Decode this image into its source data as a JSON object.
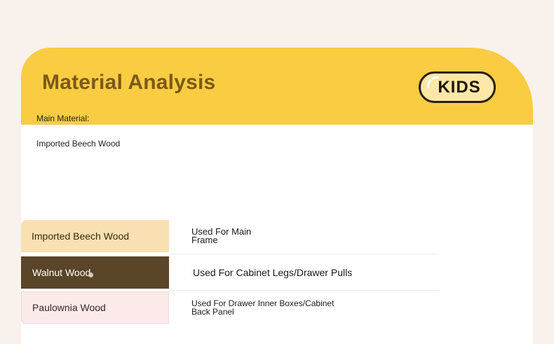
{
  "header": {
    "title": "Material Analysis",
    "badge": "KIDS"
  },
  "info": {
    "label": "Main Material:",
    "value": "Imported Beech Wood"
  },
  "rows": [
    {
      "material": "Imported Beech Wood",
      "use_lines": [
        "Used For Main",
        "Frame"
      ]
    },
    {
      "material": "Walnut Wood",
      "use_lines": [
        "Used For Cabinet Legs/Drawer Pulls"
      ]
    },
    {
      "material": "Paulownia Wood",
      "use_lines": [
        "Used For Drawer Inner Boxes/Cabinet",
        "Back Panel"
      ]
    }
  ],
  "colors": {
    "page_background": "#f8f1ec",
    "header": "#f9cc42",
    "title": "#7a5a17",
    "beech": "#f9e0b2",
    "walnut": "#5a4528",
    "paulownia": "#fce9ea"
  }
}
